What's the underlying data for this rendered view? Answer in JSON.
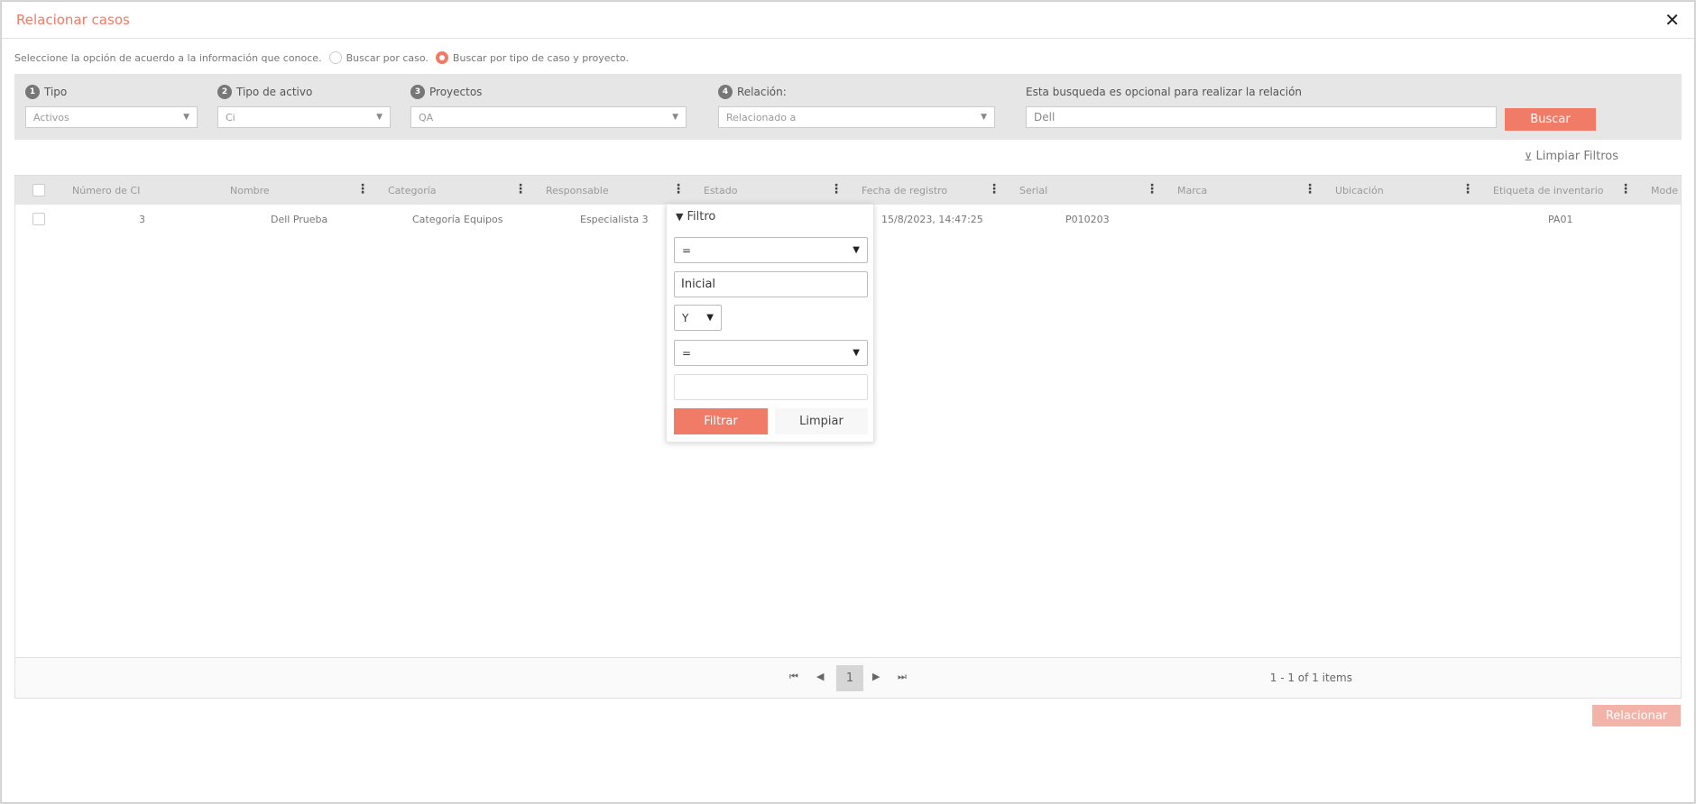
{
  "modal": {
    "title": "Relacionar casos",
    "close": "✕"
  },
  "search_mode": {
    "prompt": "Seleccione la opción de acuerdo a la información que conoce.",
    "options": [
      "Buscar por caso.",
      "Buscar por tipo de caso y proyecto."
    ],
    "selected": "Buscar por tipo de caso y proyecto."
  },
  "filters": {
    "tipo": {
      "step": "1",
      "label": "Tipo",
      "value": "Activos"
    },
    "tipo_activo": {
      "step": "2",
      "label": "Tipo de activo",
      "value": "Ci"
    },
    "proyectos": {
      "step": "3",
      "label": "Proyectos",
      "value": "QA"
    },
    "relacion": {
      "step": "4",
      "label": "Relación:",
      "value": "Relacionado a"
    },
    "optional": {
      "label": "Esta busqueda es opcional para realizar la relación",
      "value": "Dell"
    },
    "search_button": "Buscar"
  },
  "clear_filters": "Limpiar Filtros",
  "grid": {
    "columns": [
      "Número de CI",
      "Nombre",
      "Categoría",
      "Responsable",
      "Estado",
      "Fecha de registro",
      "Serial",
      "Marca",
      "Ubicación",
      "Etiqueta de inventario",
      "Mode"
    ],
    "rows": [
      {
        "numero": "3",
        "nombre": "Dell Prueba",
        "categoria": "Categoría Equipos",
        "responsable": "Especialista 3",
        "fecha": "15/8/2023, 14:47:25",
        "serial": "P010203",
        "etiqueta": "PA01"
      }
    ]
  },
  "pager": {
    "first": "⏮",
    "prev": "◀",
    "page": "1",
    "next": "▶",
    "last": "⏭",
    "info": "1 - 1 of 1 items"
  },
  "relacionar_button": "Relacionar",
  "filter_popup": {
    "title": "Filtro",
    "operator1": "=",
    "value1": "Inicial",
    "logic": "Y",
    "operator2": "=",
    "value2": "",
    "filter_button": "Filtrar",
    "clear_button": "Limpiar"
  }
}
